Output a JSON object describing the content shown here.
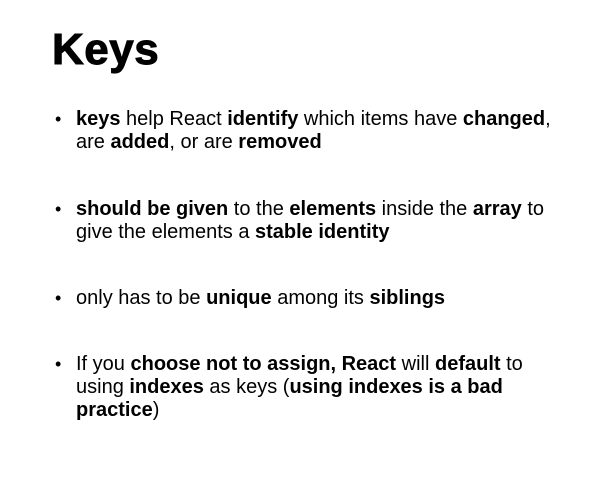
{
  "slide": {
    "title": "Keys",
    "bullets": [
      {
        "parts": [
          {
            "text": "keys",
            "bold": true
          },
          {
            "text": " help React ",
            "bold": false
          },
          {
            "text": "identify",
            "bold": true
          },
          {
            "text": " which items have ",
            "bold": false
          },
          {
            "text": "changed",
            "bold": true
          },
          {
            "text": ", are ",
            "bold": false
          },
          {
            "text": "added",
            "bold": true
          },
          {
            "text": ", or are ",
            "bold": false
          },
          {
            "text": "removed",
            "bold": true
          }
        ]
      },
      {
        "parts": [
          {
            "text": "should be given",
            "bold": true
          },
          {
            "text": " to the ",
            "bold": false
          },
          {
            "text": "elements",
            "bold": true
          },
          {
            "text": " inside the ",
            "bold": false
          },
          {
            "text": "array",
            "bold": true
          },
          {
            "text": " to give the elements a ",
            "bold": false
          },
          {
            "text": "stable identity",
            "bold": true
          }
        ]
      },
      {
        "parts": [
          {
            "text": "only has to be ",
            "bold": false
          },
          {
            "text": "unique",
            "bold": true
          },
          {
            "text": " among its ",
            "bold": false
          },
          {
            "text": "siblings",
            "bold": true
          }
        ]
      },
      {
        "parts": [
          {
            "text": "If you ",
            "bold": false
          },
          {
            "text": "choose not to assign, React",
            "bold": true
          },
          {
            "text": " will ",
            "bold": false
          },
          {
            "text": "default",
            "bold": true
          },
          {
            "text": " to using ",
            "bold": false
          },
          {
            "text": "indexes",
            "bold": true
          },
          {
            "text": " as keys (",
            "bold": false
          },
          {
            "text": "using indexes is a bad practice",
            "bold": true
          },
          {
            "text": ")",
            "bold": false
          }
        ]
      }
    ]
  }
}
